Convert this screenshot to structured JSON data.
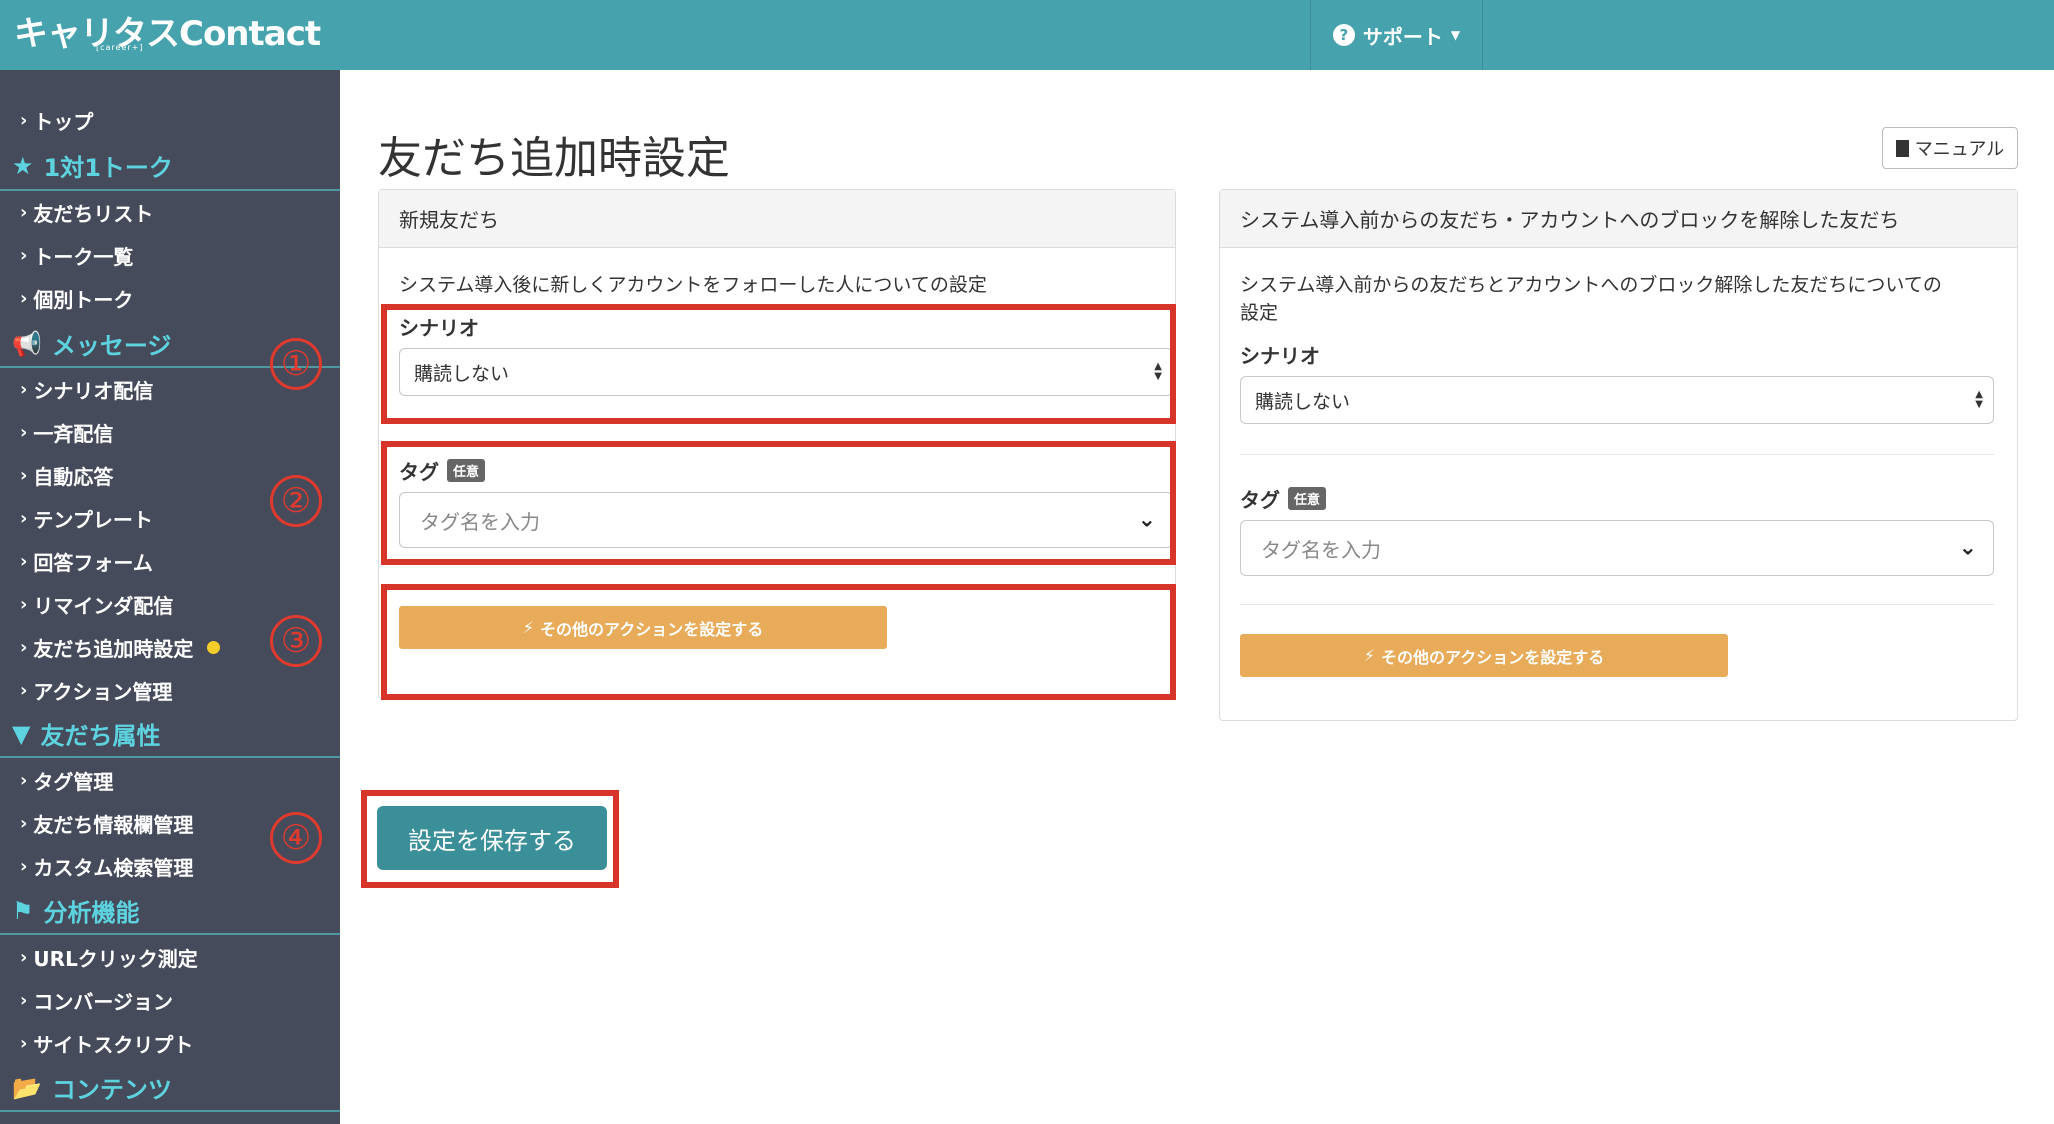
{
  "header": {
    "logo": "キャリタスContact",
    "logo_sub": "[career+]",
    "support": "サポート"
  },
  "sidebar": {
    "items": [
      {
        "label": "トップ"
      },
      {
        "label": "友だちリスト"
      },
      {
        "label": "トーク一覧"
      },
      {
        "label": "個別トーク"
      },
      {
        "label": "シナリオ配信"
      },
      {
        "label": "一斉配信"
      },
      {
        "label": "自動応答"
      },
      {
        "label": "テンプレート"
      },
      {
        "label": "回答フォーム"
      },
      {
        "label": "リマインダ配信"
      },
      {
        "label": "友だち追加時設定"
      },
      {
        "label": "アクション管理"
      },
      {
        "label": "タグ管理"
      },
      {
        "label": "友だち情報欄管理"
      },
      {
        "label": "カスタム検索管理"
      },
      {
        "label": "URLクリック測定"
      },
      {
        "label": "コンバージョン"
      },
      {
        "label": "サイトスクリプト"
      }
    ],
    "sections": [
      {
        "label": "1対1トーク"
      },
      {
        "label": "メッセージ"
      },
      {
        "label": "友だち属性"
      },
      {
        "label": "分析機能"
      },
      {
        "label": "コンテンツ"
      }
    ]
  },
  "annotations": [
    "①",
    "②",
    "③",
    "④"
  ],
  "main": {
    "title": "友だち追加時設定",
    "manual": "マニュアル",
    "left_panel": {
      "header": "新規友だち",
      "description": "システム導入後に新しくアカウントをフォローした人についての設定",
      "scenario_label": "シナリオ",
      "scenario_value": "購読しない",
      "tag_label": "タグ",
      "tag_badge": "任意",
      "tag_placeholder": "タグ名を入力",
      "action_button": "その他のアクションを設定する"
    },
    "right_panel": {
      "header": "システム導入前からの友だち・アカウントへのブロックを解除した友だち",
      "description_line1": "システム導入前からの友だちとアカウントへのブロック解除した友だちについての",
      "description_line2": "設定",
      "scenario_label": "シナリオ",
      "scenario_value": "購読しない",
      "tag_label": "タグ",
      "tag_badge": "任意",
      "tag_placeholder": "タグ名を入力",
      "action_button": "その他のアクションを設定する"
    },
    "save_button": "設定を保存する"
  },
  "colors": {
    "header_bg": "#46a3ad",
    "sidebar_bg": "#454b5a",
    "section_text": "#5ed3e0",
    "action_button": "#e8ab5a",
    "save_button": "#3b8f98",
    "annotation_red": "#d8352a"
  }
}
